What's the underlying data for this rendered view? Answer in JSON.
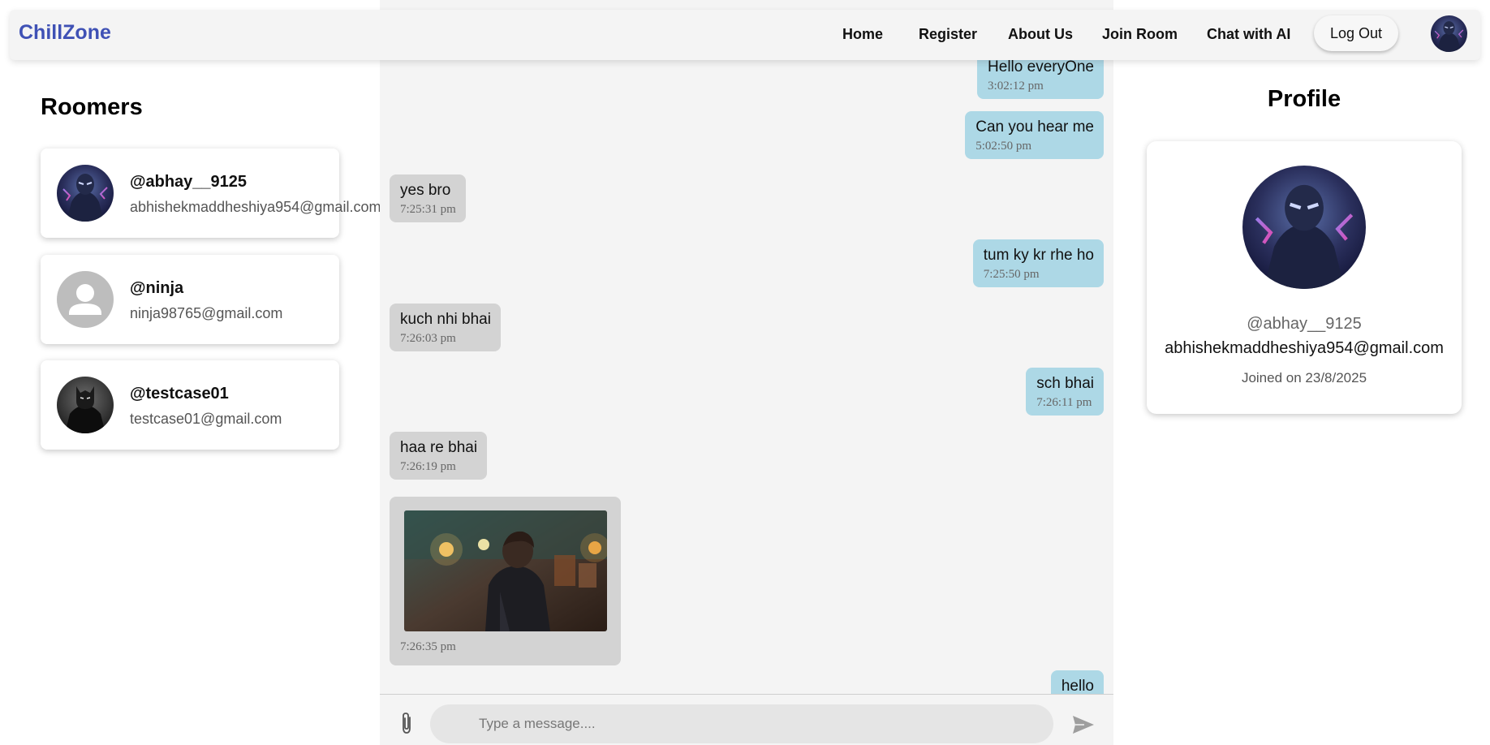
{
  "nav": {
    "brand": "ChillZone",
    "links": [
      "Home",
      "Register",
      "About Us",
      "Join Room",
      "Chat with AI"
    ],
    "logout_label": "Log Out"
  },
  "roomers": {
    "title": "Roomers",
    "items": [
      {
        "handle": "@abhay__9125",
        "email": "abhishekmaddheshiya954@gmail.com",
        "avatar": "superhero-avatar"
      },
      {
        "handle": "@ninja",
        "email": "ninja98765@gmail.com",
        "avatar": "default-user-avatar"
      },
      {
        "handle": "@testcase01",
        "email": "testcase01@gmail.com",
        "avatar": "dark-knight-avatar"
      }
    ]
  },
  "chat": {
    "messages": [
      {
        "direction": "out",
        "text": "Hello everyOne",
        "time": "3:02:12 pm"
      },
      {
        "direction": "out",
        "text": "Can you hear me",
        "time": "5:02:50 pm"
      },
      {
        "direction": "in",
        "text": "yes bro",
        "time": "7:25:31 pm"
      },
      {
        "direction": "out",
        "text": "tum ky kr rhe ho",
        "time": "7:25:50 pm"
      },
      {
        "direction": "in",
        "text": "kuch nhi bhai",
        "time": "7:26:03 pm"
      },
      {
        "direction": "out",
        "text": "sch bhai",
        "time": "7:26:11 pm"
      },
      {
        "direction": "in",
        "text": "haa re bhai",
        "time": "7:26:19 pm"
      },
      {
        "direction": "in",
        "text": "",
        "time": "7:26:35 pm",
        "image": "anime-boy-photo"
      },
      {
        "direction": "out",
        "text": "hello",
        "time": ""
      }
    ],
    "input_placeholder": "Type a message...."
  },
  "profile": {
    "title": "Profile",
    "handle": "@abhay__9125",
    "email": "abhishekmaddheshiya954@gmail.com",
    "joined": "Joined on 23/8/2025"
  },
  "colors": {
    "brand": "#3f51b5",
    "outgoing_bubble": "#add8e6",
    "incoming_bubble": "#d3d3d3",
    "chat_background": "#f4f4f4"
  }
}
